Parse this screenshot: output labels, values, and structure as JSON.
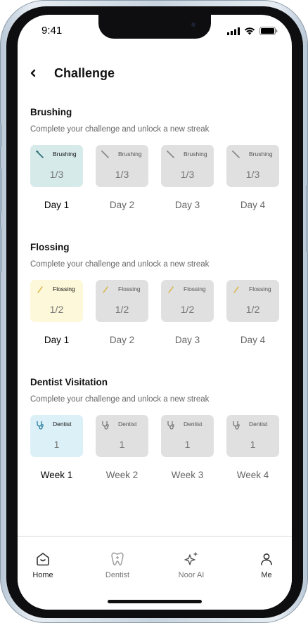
{
  "status_bar": {
    "time": "9:41"
  },
  "header": {
    "back_icon": "chevron-left-icon",
    "title": "Challenge"
  },
  "sections": [
    {
      "title": "Brushing",
      "subtitle": "Complete your challenge and unlock a new streak",
      "icon": "toothbrush-icon",
      "active_color": "#d6eae9",
      "cards": [
        {
          "label": "Brushing",
          "count": "1/3",
          "active": true
        },
        {
          "label": "Brushing",
          "count": "1/3",
          "active": false
        },
        {
          "label": "Brushing",
          "count": "1/3",
          "active": false
        },
        {
          "label": "Brushing",
          "count": "1/3",
          "active": false
        }
      ],
      "periods": [
        "Day 1",
        "Day 2",
        "Day 3",
        "Day 4"
      ]
    },
    {
      "title": "Flossing",
      "subtitle": "Complete your challenge and unlock a new streak",
      "icon": "floss-icon",
      "active_color": "#fdf8d9",
      "cards": [
        {
          "label": "Flossing",
          "count": "1/2",
          "active": true
        },
        {
          "label": "Flossing",
          "count": "1/2",
          "active": false
        },
        {
          "label": "Flossing",
          "count": "1/2",
          "active": false
        },
        {
          "label": "Flossing",
          "count": "1/2",
          "active": false
        }
      ],
      "periods": [
        "Day 1",
        "Day 2",
        "Day 3",
        "Day 4"
      ]
    },
    {
      "title": "Dentist Visitation",
      "subtitle": "Complete your challenge and unlock a new streak",
      "icon": "stethoscope-icon",
      "active_color": "#dcf0f7",
      "cards": [
        {
          "label": "Dentist",
          "count": "1",
          "active": true
        },
        {
          "label": "Dentist",
          "count": "1",
          "active": false
        },
        {
          "label": "Dentist",
          "count": "1",
          "active": false
        },
        {
          "label": "Dentist",
          "count": "1",
          "active": false
        }
      ],
      "periods": [
        "Week 1",
        "Week 2",
        "Week 3",
        "Week 4"
      ]
    }
  ],
  "tabbar": {
    "home": {
      "label": "Home",
      "icon": "home-icon"
    },
    "dentist": {
      "label": "Dentist",
      "icon": "tooth-icon"
    },
    "noor": {
      "label": "Noor AI",
      "icon": "sparkle-icon"
    },
    "me": {
      "label": "Me",
      "icon": "user-icon"
    }
  },
  "colors": {
    "card_inactive": "#e0e0e0",
    "text_muted": "#666666"
  }
}
